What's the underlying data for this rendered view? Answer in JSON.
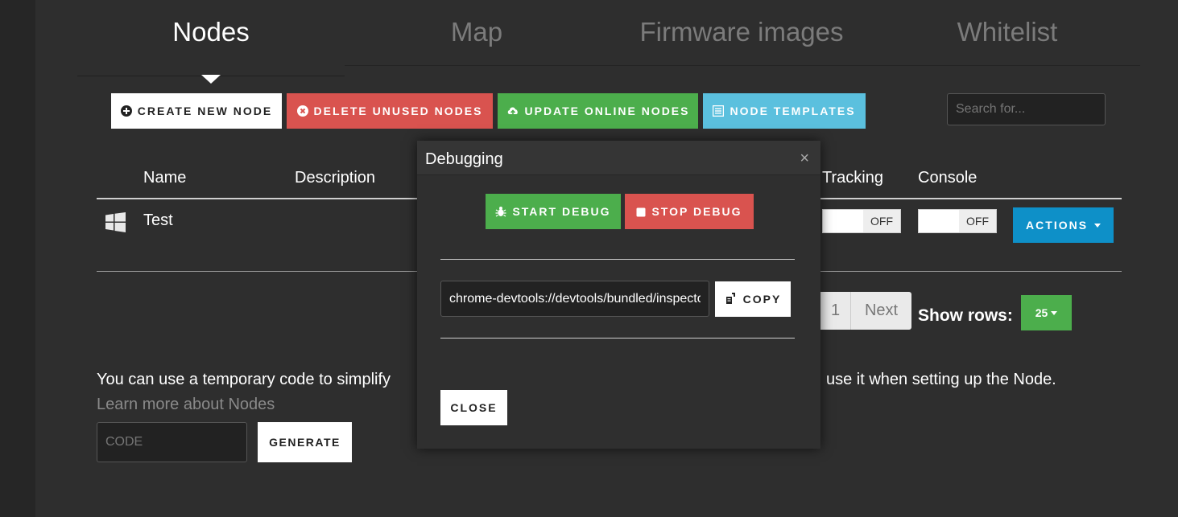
{
  "tabs": [
    "Nodes",
    "Map",
    "Firmware images",
    "Whitelist"
  ],
  "toolbar": {
    "create_label": "CREATE NEW NODE",
    "delete_label": "DELETE UNUSED NODES",
    "update_label": "UPDATE ONLINE NODES",
    "templates_label": "NODE TEMPLATES"
  },
  "search": {
    "placeholder": "Search for..."
  },
  "table": {
    "headers": {
      "name": "Name",
      "description": "Description",
      "tracking": "Tracking",
      "console": "Console"
    },
    "rows": [
      {
        "os_icon": "windows-icon",
        "name": "Test",
        "tracking": "OFF",
        "console": "OFF",
        "actions_label": "ACTIONS"
      }
    ]
  },
  "pagination": {
    "page": "1",
    "next_label": "Next",
    "show_rows_label": "Show rows:",
    "rows_value": "25"
  },
  "temp_code": {
    "text_left": "You can use a temporary code to simplify",
    "text_right": "use it when setting up the Node.",
    "learn_more": "Learn more about Nodes",
    "placeholder": "CODE",
    "generate_label": "GENERATE"
  },
  "modal": {
    "title": "Debugging",
    "close_x": "×",
    "start_label": "START DEBUG",
    "stop_label": "STOP DEBUG",
    "url_value": "chrome-devtools://devtools/bundled/inspector.html",
    "copy_label": "COPY",
    "close_label": "CLOSE"
  },
  "colors": {
    "red": "#d9534f",
    "green": "#4cae4c",
    "cyan": "#5bc0de",
    "blue": "#0e90c8",
    "background": "#2e2e2e"
  }
}
